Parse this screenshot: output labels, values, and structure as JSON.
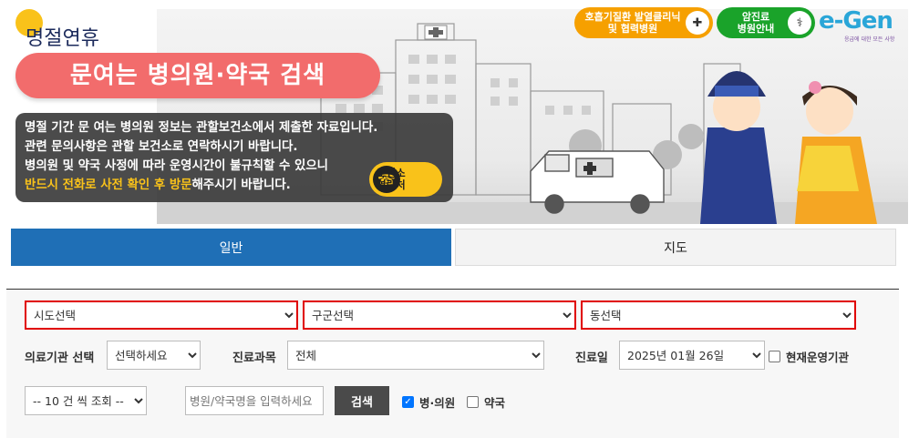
{
  "banner": {
    "holiday_title": "명절연휴",
    "main_title": "문여는 병의원·약국 검색",
    "notice_lines": [
      "명절 기간 문 여는 병의원 정보는 관할보건소에서 제출한 자료입니다.",
      "관련 문의사항은 관할 보건소로 연락하시기 바랍니다.",
      "병의원 및 약국 사정에 따라 운영시간이 불규칙할 수 있으니"
    ],
    "notice_highlight": "반드시 전화로 사전 확인 후 방문",
    "notice_tail": "해주시기 바랍니다.",
    "contact_btn": [
      "보건소",
      "연락처"
    ],
    "clinic_btn": [
      "호흡기질환 발열클리닉",
      "및 협력병원"
    ],
    "cancer_btn": [
      "암진료",
      "병원안내"
    ],
    "logo_text": "e-Gen",
    "logo_sub": "응급에 대한 모든 사항"
  },
  "tabs": {
    "general": "일반",
    "map": "지도"
  },
  "search": {
    "sido": "시도선택",
    "gugun": "구군선택",
    "dong": "동선택",
    "org_label": "의료기관 선택",
    "org_value": "선택하세요",
    "dept_label": "진료과목",
    "dept_value": "전체",
    "date_label": "진료일",
    "date_value": "2025년 01월 26일",
    "open_now_label": "현재운영기관",
    "page_size": "-- 10 건 씩 조회 --",
    "keyword_placeholder": "병원/약국명을 입력하세요",
    "search_btn": "검색",
    "hospital_label": "병·의원",
    "pharmacy_label": "약국",
    "hospital_checked": true,
    "pharmacy_checked": false
  },
  "colors": {
    "tab_active": "#1f6fb6",
    "title_pill": "#f26c6c",
    "highlight": "#f9c21a",
    "required_border": "#e00000"
  }
}
